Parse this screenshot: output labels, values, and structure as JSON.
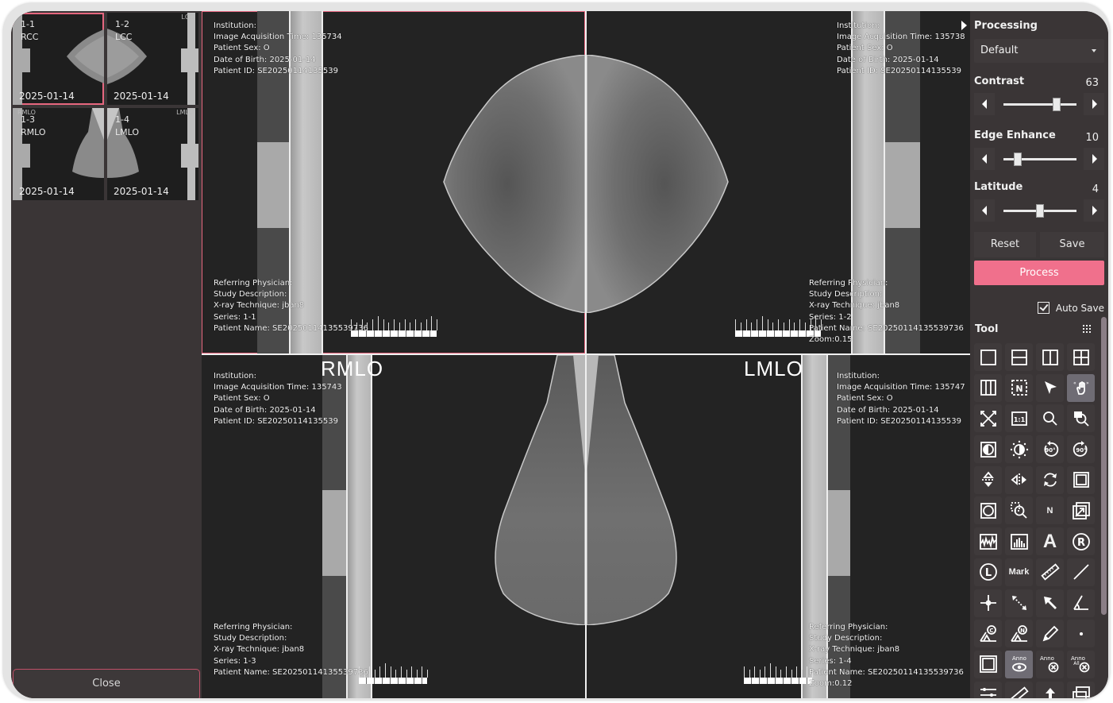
{
  "thumbnails": [
    {
      "num": "1-1",
      "view": "RCC",
      "date": "2025-01-14",
      "corner": "",
      "selected": true
    },
    {
      "num": "1-2",
      "view": "LCC",
      "date": "2025-01-14",
      "corner": "LCC",
      "selected": false
    },
    {
      "num": "1-3",
      "view": "RMLO",
      "date": "2025-01-14",
      "corner": "RMLO",
      "selected": false
    },
    {
      "num": "1-4",
      "view": "LMLO",
      "date": "2025-01-14",
      "corner": "LMLO",
      "selected": false
    }
  ],
  "close_label": "Close",
  "viewports": [
    {
      "view": "RCC",
      "big_label": "",
      "top": [
        "Institution:",
        "Image Acquisition Time: 135734",
        "Patient Sex: O",
        "Date of Birth: 2025-01-14",
        "Patient ID: SE20250114135539"
      ],
      "bottom": [
        "Referring Physician:",
        "Study Description:",
        "X-ray Technique: jban8",
        "Series: 1-1",
        "Patient Name: SE20250114135539736"
      ],
      "zoom": ""
    },
    {
      "view": "LCC",
      "big_label": "",
      "top": [
        "Institution:",
        "Image Acquisition Time: 135738",
        "Patient Sex: O",
        "Date of Birth: 2025-01-14",
        "Patient ID: SE20250114135539"
      ],
      "bottom": [
        "Referring Physician:",
        "Study Description:",
        "X-ray Technique: jban8",
        "Series: 1-2",
        "Patient Name: SE20250114135539736"
      ],
      "zoom": "Zoom:0.15"
    },
    {
      "view": "RMLO",
      "big_label": "RMLO",
      "top": [
        "Institution:",
        "Image Acquisition Time: 135743",
        "Patient Sex: O",
        "Date of Birth: 2025-01-14",
        "Patient ID: SE20250114135539"
      ],
      "bottom": [
        "Referring Physician:",
        "Study Description:",
        "X-ray Technique: jban8",
        "Series: 1-3",
        "Patient Name: SE20250114135539736"
      ],
      "zoom": ""
    },
    {
      "view": "LMLO",
      "big_label": "LMLO",
      "top": [
        "Institution:",
        "Image Acquisition Time: 135747",
        "Patient Sex: O",
        "Date of Birth: 2025-01-14",
        "Patient ID: SE20250114135539"
      ],
      "bottom": [
        "Referring Physician:",
        "Study Description:",
        "X-ray Technique: jban8",
        "Series: 1-4",
        "Patient Name: SE20250114135539736"
      ],
      "zoom": "Zoom:0.12"
    }
  ],
  "processing": {
    "title": "Processing",
    "preset": "Default",
    "sliders": [
      {
        "label": "Contrast",
        "value": "63",
        "fraction": 0.73
      },
      {
        "label": "Edge Enhance",
        "value": "10",
        "fraction": 0.2
      },
      {
        "label": "Latitude",
        "value": "4",
        "fraction": 0.5
      }
    ],
    "reset_label": "Reset",
    "save_label": "Save",
    "process_label": "Process",
    "process_color": "#f0708c",
    "autosave_label": "Auto Save",
    "autosave_checked": true
  },
  "tool": {
    "title": "Tool",
    "items": [
      {
        "name": "layout-1x1-icon"
      },
      {
        "name": "layout-2-rows-icon"
      },
      {
        "name": "layout-2-cols-icon"
      },
      {
        "name": "layout-2x2-icon"
      },
      {
        "name": "layout-3-cols-icon"
      },
      {
        "name": "layout-n-icon"
      },
      {
        "name": "select-pointer-icon"
      },
      {
        "name": "pan-hand-icon",
        "active": true
      },
      {
        "name": "fit-screen-icon"
      },
      {
        "name": "actual-size-icon",
        "text": "1:1"
      },
      {
        "name": "zoom-icon"
      },
      {
        "name": "magnifier-icon"
      },
      {
        "name": "invert-icon"
      },
      {
        "name": "brightness-icon"
      },
      {
        "name": "rotate-ccw-90-icon",
        "text": "90°"
      },
      {
        "name": "rotate-cw-90-icon",
        "text": "90°"
      },
      {
        "name": "flip-vertical-icon"
      },
      {
        "name": "flip-horizontal-icon"
      },
      {
        "name": "reset-rotate-icon"
      },
      {
        "name": "rectangle-roi-icon"
      },
      {
        "name": "ellipse-roi-icon"
      },
      {
        "name": "zoom-region-icon"
      },
      {
        "name": "n-marker-icon",
        "text": "N"
      },
      {
        "name": "expand-icon"
      },
      {
        "name": "histogram-wave-icon"
      },
      {
        "name": "histogram-bars-icon"
      },
      {
        "name": "text-annotation-icon",
        "text": "A"
      },
      {
        "name": "right-marker-icon",
        "text": "R"
      },
      {
        "name": "left-marker-icon",
        "text": "L"
      },
      {
        "name": "mark-icon",
        "text": "Mark"
      },
      {
        "name": "ruler-icon"
      },
      {
        "name": "line-icon"
      },
      {
        "name": "crosshair-icon"
      },
      {
        "name": "bidirectional-arrow-icon"
      },
      {
        "name": "arrow-annotation-icon"
      },
      {
        "name": "angle-icon"
      },
      {
        "name": "cobb-angle-icon",
        "text": "C"
      },
      {
        "name": "n-angle-icon",
        "text": "N"
      },
      {
        "name": "pencil-icon"
      },
      {
        "name": "point-icon"
      },
      {
        "name": "frame-icon"
      },
      {
        "name": "anno-show-icon",
        "text": "Anno",
        "active": true
      },
      {
        "name": "anno-delete-icon",
        "text": "Anno"
      },
      {
        "name": "anno-delete-all-icon",
        "text": "Anno All"
      },
      {
        "name": "settings-sliders-icon"
      },
      {
        "name": "calibration-ruler-icon"
      },
      {
        "name": "export-icon"
      },
      {
        "name": "window-icon"
      }
    ]
  }
}
